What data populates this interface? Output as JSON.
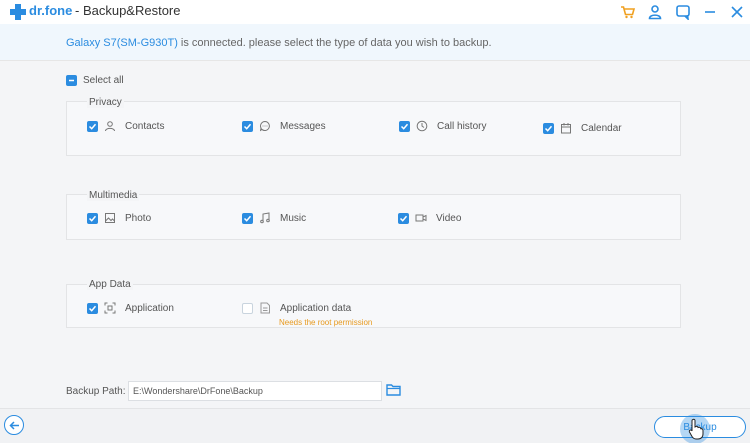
{
  "titlebar": {
    "brand": "dr.fone",
    "title": "- Backup&Restore",
    "icons": [
      "cart-icon",
      "user-icon",
      "feedback-icon",
      "minimize-icon",
      "close-icon"
    ]
  },
  "banner": {
    "device": "Galaxy S7(SM-G930T)",
    "message": " is connected. please select the type of data you wish to backup."
  },
  "select_all": {
    "label": "Select all",
    "state": "partial"
  },
  "groups": {
    "privacy": {
      "title": "Privacy",
      "items": [
        {
          "label": "Contacts",
          "checked": true,
          "icon": "contact-icon"
        },
        {
          "label": "Messages",
          "checked": true,
          "icon": "message-icon"
        },
        {
          "label": "Call history",
          "checked": true,
          "icon": "clock-icon"
        },
        {
          "label": "Calendar",
          "checked": true,
          "icon": "calendar-icon"
        }
      ]
    },
    "multimedia": {
      "title": "Multimedia",
      "items": [
        {
          "label": "Photo",
          "checked": true,
          "icon": "photo-icon"
        },
        {
          "label": "Music",
          "checked": true,
          "icon": "music-icon"
        },
        {
          "label": "Video",
          "checked": true,
          "icon": "video-icon"
        }
      ]
    },
    "app_data": {
      "title": "App Data",
      "items": [
        {
          "label": "Application",
          "checked": true,
          "icon": "app-icon"
        },
        {
          "label": "Application data",
          "checked": false,
          "icon": "app-data-icon",
          "note": "Needs the root permission"
        }
      ]
    }
  },
  "backup_path": {
    "label": "Backup Path:",
    "value": "E:\\Wondershare\\DrFone\\Backup"
  },
  "footer": {
    "backup_label": "Backup"
  },
  "colors": {
    "accent": "#2b8ce0",
    "warning": "#e79a20",
    "background": "#f4f5f7"
  }
}
